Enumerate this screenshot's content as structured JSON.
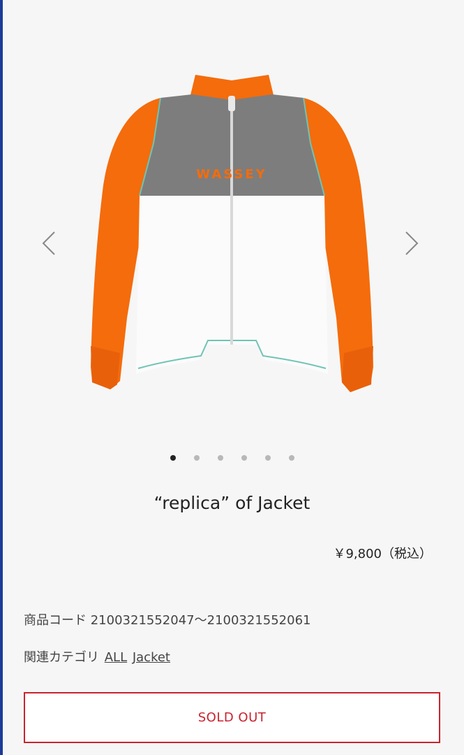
{
  "product": {
    "title": "“replica” of Jacket",
    "price": "￥9,800（税込）",
    "code_label": "商品コード",
    "code_value": "2100321552047〜2100321552061",
    "category_label": "関連カテゴリ",
    "categories": [
      "ALL",
      "Jacket"
    ],
    "brand_print": "WASSEY",
    "sold_out_label": "SOLD OUT"
  },
  "carousel": {
    "total_slides": 6,
    "active_slide": 1
  },
  "colors": {
    "accent_border": "#1e3a9a",
    "sold_out_red": "#c9232f",
    "sleeve_orange": "#f46c0c",
    "yoke_gray": "#7d7d7d",
    "body_white": "#fbfbfb",
    "stitch_teal": "#6fc4b5"
  },
  "icons": {
    "prev": "chevron-left-icon",
    "next": "chevron-right-icon"
  }
}
